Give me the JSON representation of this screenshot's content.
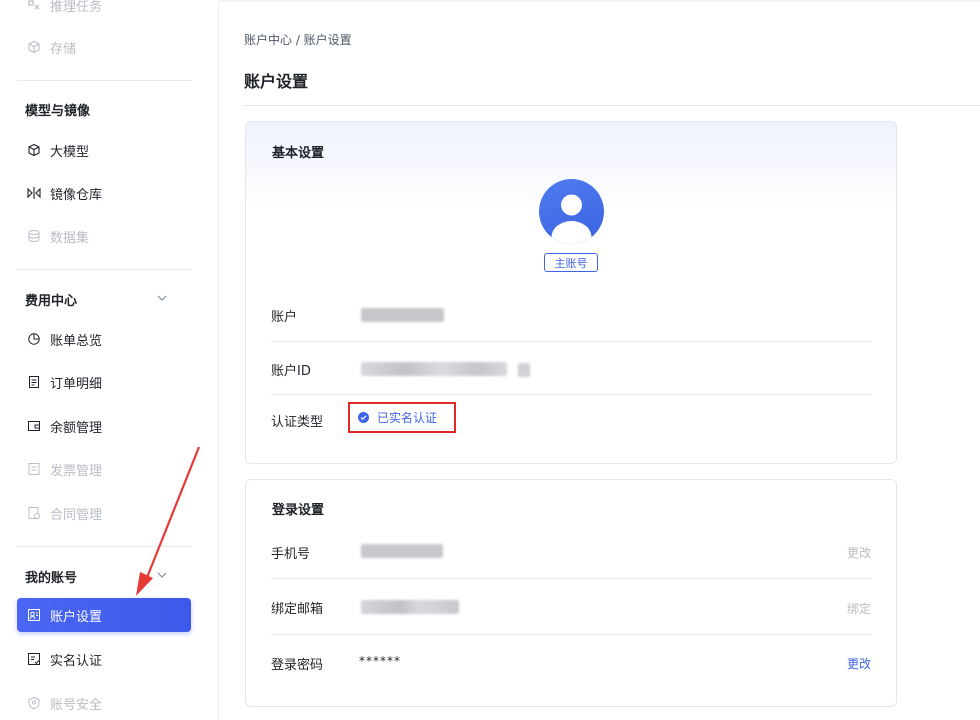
{
  "sidebar": {
    "top_items": [
      {
        "label": "推理任务",
        "icon": "inference-icon"
      },
      {
        "label": "存储",
        "icon": "storage-icon"
      }
    ],
    "sections": [
      {
        "title": "模型与镜像",
        "items": [
          {
            "label": "大模型",
            "icon": "cube-icon"
          },
          {
            "label": "镜像仓库",
            "icon": "mirror-icon"
          },
          {
            "label": "数据集",
            "icon": "dataset-icon"
          }
        ]
      },
      {
        "title": "费用中心",
        "items": [
          {
            "label": "账单总览",
            "icon": "bill-icon"
          },
          {
            "label": "订单明细",
            "icon": "order-icon"
          },
          {
            "label": "余额管理",
            "icon": "balance-icon"
          },
          {
            "label": "发票管理",
            "icon": "invoice-icon"
          },
          {
            "label": "合同管理",
            "icon": "contract-icon"
          }
        ]
      },
      {
        "title": "我的账号",
        "items": [
          {
            "label": "账户设置",
            "icon": "account-settings-icon"
          },
          {
            "label": "实名认证",
            "icon": "verify-icon"
          },
          {
            "label": "账号安全",
            "icon": "shield-icon"
          }
        ]
      }
    ]
  },
  "breadcrumb": "账户中心 / 账户设置",
  "page_title": "账户设置",
  "basic": {
    "title": "基本设置",
    "badge": "主账号",
    "rows": [
      {
        "label": "账户"
      },
      {
        "label": "账户ID"
      },
      {
        "label": "认证类型",
        "value": "已实名认证"
      }
    ]
  },
  "login": {
    "title": "登录设置",
    "rows": [
      {
        "label": "手机号",
        "action": "更改"
      },
      {
        "label": "绑定邮箱",
        "action": "绑定"
      },
      {
        "label": "登录密码",
        "value": "******",
        "action": "更改"
      }
    ]
  },
  "colors": {
    "accent": "#3f63e6",
    "highlight_border": "#e02a2a",
    "annotation_arrow": "#e53935"
  }
}
